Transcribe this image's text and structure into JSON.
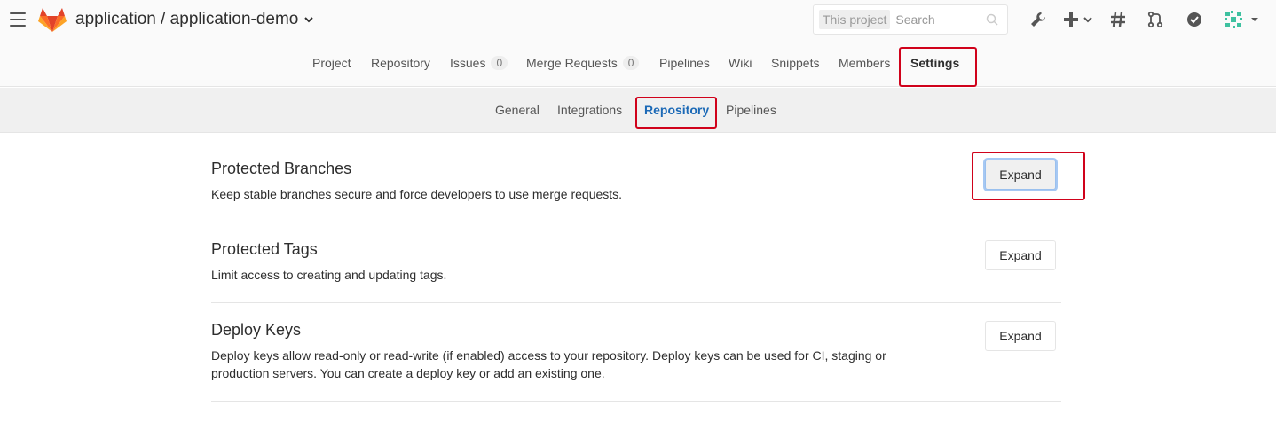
{
  "header": {
    "project_path": "application / application-demo",
    "search": {
      "scope": "This project",
      "placeholder": "Search"
    }
  },
  "main_nav": [
    {
      "label": "Project"
    },
    {
      "label": "Repository"
    },
    {
      "label": "Issues",
      "badge": "0"
    },
    {
      "label": "Merge Requests",
      "badge": "0"
    },
    {
      "label": "Pipelines"
    },
    {
      "label": "Wiki"
    },
    {
      "label": "Snippets"
    },
    {
      "label": "Members"
    },
    {
      "label": "Settings",
      "active": true
    }
  ],
  "sub_nav": [
    {
      "label": "General"
    },
    {
      "label": "Integrations"
    },
    {
      "label": "Repository",
      "active": true
    },
    {
      "label": "Pipelines"
    }
  ],
  "sections": [
    {
      "title": "Protected Branches",
      "description": "Keep stable branches secure and force developers to use merge requests.",
      "button": "Expand"
    },
    {
      "title": "Protected Tags",
      "description": "Limit access to creating and updating tags.",
      "button": "Expand"
    },
    {
      "title": "Deploy Keys",
      "description": "Deploy keys allow read-only or read-write (if enabled) access to your repository. Deploy keys can be used for CI, staging or production servers. You can create a deploy key or add an existing one.",
      "button": "Expand"
    }
  ],
  "colors": {
    "accent": "#1b69b6",
    "highlight": "#d0021b",
    "logo_orange": "#fc6d26"
  }
}
